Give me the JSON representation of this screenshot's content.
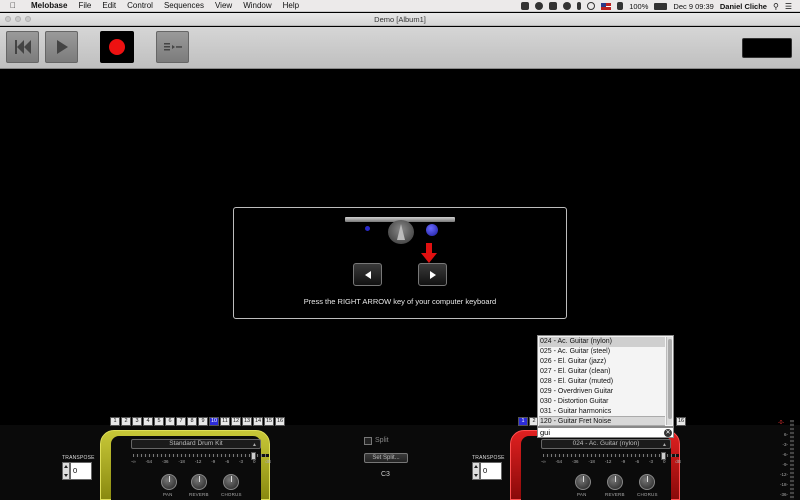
{
  "menubar": {
    "app_name": "Melobase",
    "items": [
      "File",
      "Edit",
      "Control",
      "Sequences",
      "View",
      "Window",
      "Help"
    ],
    "battery": "100%",
    "clock": "Dec 9  09:39",
    "user": "Daniel Cliche"
  },
  "window": {
    "title": "Demo [Album1]"
  },
  "dialog": {
    "message": "Press the RIGHT ARROW key of your computer keyboard"
  },
  "channels": [
    "1",
    "2",
    "3",
    "4",
    "5",
    "6",
    "7",
    "8",
    "9",
    "10",
    "11",
    "12",
    "13",
    "14",
    "15",
    "16"
  ],
  "left_panel": {
    "active_channel": "10",
    "transpose_label": "TRANSPOSE",
    "transpose_value": "0",
    "instrument": "Standard Drum Kit",
    "scale": [
      "-∞",
      "-54",
      "-36",
      "-18",
      "-12",
      "-9",
      "-6",
      "-3",
      "0",
      "dB"
    ],
    "knob_labels": {
      "pan": "PAN",
      "reverb": "REVERB",
      "chorus": "CHORUS"
    }
  },
  "split": {
    "label": "Split",
    "button": "Set Split...",
    "note": "C3"
  },
  "right_panel": {
    "active_channel": "1",
    "visible_channels_left": [
      "1",
      "2"
    ],
    "visible_channels_right": [
      "16"
    ],
    "transpose_label": "TRANSPOSE",
    "transpose_value": "0",
    "instrument": "024 - Ac. Guitar (nylon)",
    "scale": [
      "-∞",
      "-54",
      "-36",
      "-18",
      "-12",
      "-9",
      "-6",
      "-3",
      "0",
      "dB"
    ],
    "knob_labels": {
      "pan": "PAN",
      "reverb": "REVERB",
      "chorus": "CHORUS"
    }
  },
  "dropdown": {
    "items": [
      "024 - Ac. Guitar (nylon)",
      "025 - Ac. Guitar (steel)",
      "026 - El. Guitar (jazz)",
      "027 - El. Guitar (clean)",
      "028 - El. Guitar (muted)",
      "029 - Overdriven Guitar",
      "030 - Distortion Guitar",
      "031 - Guitar harmonics",
      "120 - Guitar Fret Noise"
    ],
    "search_value": "gui"
  },
  "level_meter": [
    "-0-",
    "6-",
    "-3-",
    "-6-",
    "-9-",
    "-12-",
    "-18-",
    "-36-"
  ]
}
